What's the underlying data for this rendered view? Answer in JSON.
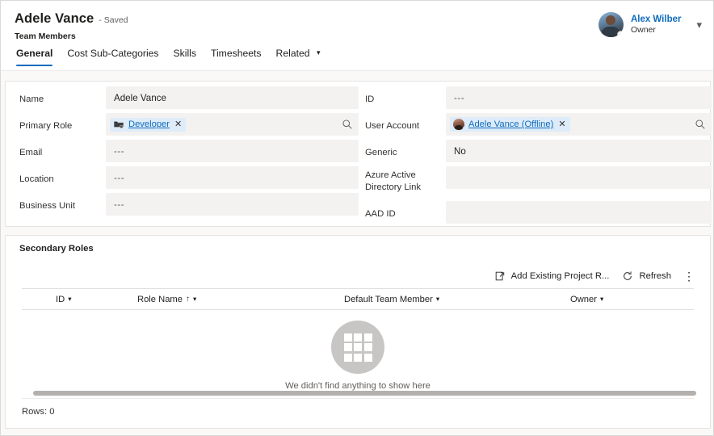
{
  "header": {
    "record_title": "Adele Vance",
    "save_status": "- Saved",
    "entity_name": "Team Members",
    "tabs": [
      {
        "label": "General",
        "active": true,
        "has_chevron": false
      },
      {
        "label": "Cost Sub-Categories",
        "active": false,
        "has_chevron": false
      },
      {
        "label": "Skills",
        "active": false,
        "has_chevron": false
      },
      {
        "label": "Timesheets",
        "active": false,
        "has_chevron": false
      },
      {
        "label": "Related",
        "active": false,
        "has_chevron": true
      }
    ],
    "active_tab_underline_color": "#0f6cbd",
    "user": {
      "name": "Alex Wilber",
      "role": "Owner",
      "name_color": "#0f6cbd",
      "avatar_icon": "user-photo-avatar",
      "presence": "offline",
      "chevron_icon": "chevron-down-icon"
    }
  },
  "form": {
    "left_column": [
      {
        "label": "Name",
        "type": "text",
        "value": "Adele Vance",
        "required": true,
        "locked": false
      },
      {
        "label": "Primary Role",
        "type": "lookup",
        "chip_text": "Developer",
        "chip_icon": "project-role-icon",
        "remove_icon": "close-icon",
        "search_icon": "search-icon",
        "required": false,
        "locked": false
      },
      {
        "label": "Email",
        "type": "text",
        "value": "---",
        "required": false,
        "locked": false
      },
      {
        "label": "Location",
        "type": "text",
        "value": "---",
        "required": false,
        "locked": false
      },
      {
        "label": "Business Unit",
        "type": "text",
        "value": "---",
        "required": false,
        "locked": false
      }
    ],
    "right_column": [
      {
        "label": "ID",
        "type": "text",
        "value": "---",
        "required": false,
        "locked": false
      },
      {
        "label": "User Account",
        "type": "lookup",
        "chip_text": "Adele Vance (Offline)",
        "chip_icon": "user-avatar-icon",
        "remove_icon": "close-icon",
        "search_icon": "search-icon",
        "required": false,
        "locked": false
      },
      {
        "label": "Generic",
        "type": "text",
        "value": "No",
        "required": false,
        "locked": false
      },
      {
        "label": "Azure Active Directory Link",
        "type": "text",
        "value": "",
        "required": false,
        "locked": true,
        "lock_icon": "lock-icon"
      },
      {
        "label": "AAD ID",
        "type": "text",
        "value": "",
        "required": false,
        "locked": true,
        "lock_icon": "lock-icon"
      }
    ]
  },
  "grid": {
    "section_title": "Secondary Roles",
    "toolbar": {
      "add_existing_label": "Add Existing Project R...",
      "add_existing_icon": "add-existing-record-icon",
      "refresh_label": "Refresh",
      "refresh_icon": "refresh-icon",
      "more_label": "⋮",
      "more_icon": "more-vertical-icon"
    },
    "columns": [
      {
        "label": "ID",
        "sorted": false,
        "sort_glyph": "",
        "chevron": "⌄"
      },
      {
        "label": "Role Name",
        "sorted": true,
        "sort_glyph": "↑",
        "chevron": "⌄"
      },
      {
        "label": "Default Team Member",
        "sorted": false,
        "sort_glyph": "",
        "chevron": "⌄"
      },
      {
        "label": "Owner",
        "sorted": false,
        "sort_glyph": "",
        "chevron": "⌄"
      }
    ],
    "rows": [],
    "empty_state": {
      "icon": "empty-grid-icon",
      "message": "We didn't find anything to show here"
    },
    "footer": {
      "rows_label": "Rows: 0"
    },
    "scrollbar": {
      "icon": "horizontal-scrollbar",
      "thumb_color": "#b3b0ad"
    }
  },
  "colors": {
    "accent": "#0f6cbd",
    "page_background": "#faf9f8",
    "card_background": "#ffffff",
    "field_background": "#f3f2f1",
    "chip_background": "#deecf9",
    "required_star": "#a4262c",
    "empty_circle": "#c8c6c4"
  }
}
